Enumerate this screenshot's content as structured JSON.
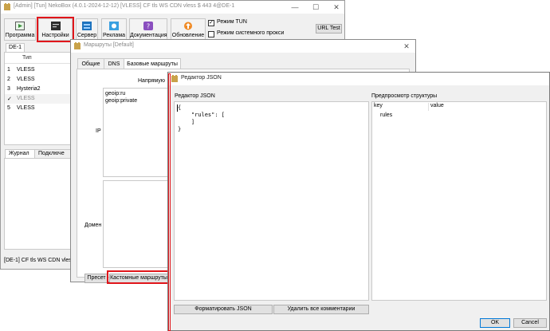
{
  "main_window": {
    "title": "[Admin] [Tun] NekoBox (4.0.1-2024-12-12) [VLESS] CF tls WS CDN vless $ 443 4@DE-1",
    "toolbar": {
      "program": "Программа",
      "settings": "Настройки",
      "server": "Сервер",
      "ads": "Реклама",
      "docs": "Документация",
      "update": "Обновление"
    },
    "tun_mode": "Режим TUN",
    "system_proxy": "Режим системного прокси",
    "url_test": "URL Test",
    "group_tab": "DE-1",
    "table": {
      "header": "Тип",
      "rows": [
        {
          "num": "1",
          "type": "VLESS",
          "check": ""
        },
        {
          "num": "2",
          "type": "VLESS",
          "check": ""
        },
        {
          "num": "3",
          "type": "Hysteria2",
          "check": ""
        },
        {
          "num": "",
          "type": "VLESS",
          "check": "✓"
        },
        {
          "num": "5",
          "type": "VLESS",
          "check": ""
        }
      ]
    },
    "bottom_tabs": [
      "Журнал",
      "Подключе"
    ],
    "status": "[DE-1] CF tls WS CDN vless $ 4"
  },
  "routes_dialog": {
    "title": "Маршруты [Default]",
    "tabs": [
      "Общие",
      "DNS",
      "Базовые маршруты"
    ],
    "column_header": "Напрямую",
    "ip_label": "IP",
    "domain_label": "Домен",
    "ip_values": [
      "geoip:ru",
      "geoip:private"
    ],
    "preset_button": "Пресет",
    "custom_routes_button": "Кастомные маршруты"
  },
  "json_dialog": {
    "title": "Редактор JSON",
    "editor_label": "Редактор JSON",
    "preview_label": "Предпросмотр структуры",
    "code_lines": [
      "{",
      "    \"rules\": [",
      "    ]",
      "}"
    ],
    "tree_headers": [
      "key",
      "value"
    ],
    "tree_items": [
      "rules"
    ],
    "format_button": "Форматировать JSON",
    "remove_comments_button": "Удалить все комментарии",
    "ok_button": "OK",
    "cancel_button": "Cancel"
  },
  "colors": {
    "highlight": "#e0161b",
    "selection": "#cce8ff"
  }
}
